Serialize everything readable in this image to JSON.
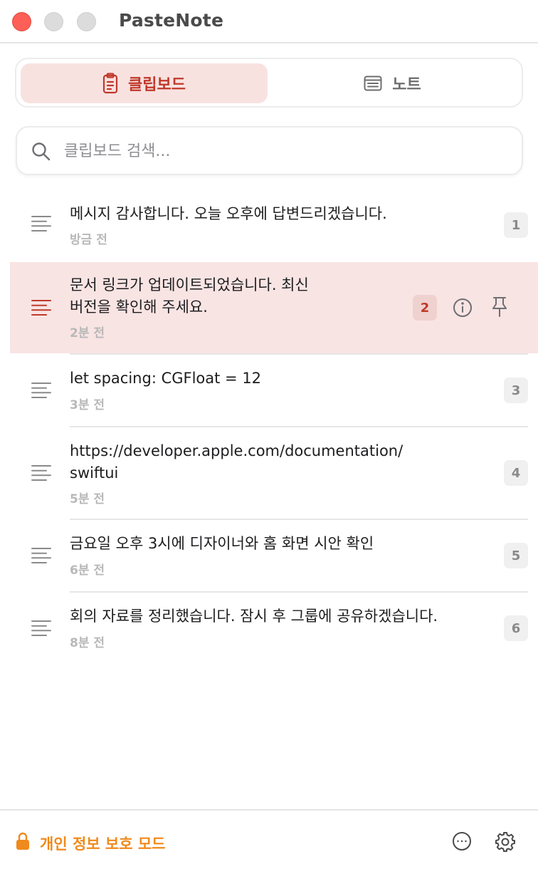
{
  "app": {
    "title": "PasteNote"
  },
  "tabs": {
    "clipboard": "클립보드",
    "notes": "노트"
  },
  "search": {
    "placeholder": "클립보드 검색..."
  },
  "items": [
    {
      "lines": [
        "메시지 감사합니다. 오늘 오후에 답변드리겠습니다."
      ],
      "time": "방금 전",
      "index": "1",
      "selected": false
    },
    {
      "lines": [
        "문서 링크가 업데이트되었습니다. 최신",
        "버전을 확인해 주세요."
      ],
      "time": "2분 전",
      "index": "2",
      "selected": true
    },
    {
      "lines": [
        "let spacing: CGFloat = 12"
      ],
      "time": "3분 전",
      "index": "3",
      "selected": false
    },
    {
      "lines": [
        "https://developer.apple.com/documentation/",
        "swiftui"
      ],
      "time": "5분 전",
      "index": "4",
      "selected": false
    },
    {
      "lines": [
        "금요일 오후 3시에 디자이너와 홈 화면 시안 확인"
      ],
      "time": "6분 전",
      "index": "5",
      "selected": false
    },
    {
      "lines": [
        "회의 자료를 정리했습니다. 잠시 후 그룹에 공유하겠습니다."
      ],
      "time": "8분 전",
      "index": "6",
      "selected": false
    }
  ],
  "footer": {
    "privacy_label": "개인 정보 보호 모드"
  },
  "icons": {
    "clipboard_tab": "clipboard-icon",
    "notes_tab": "note-icon",
    "search": "search-icon",
    "item": "text-lines-icon",
    "info": "info-icon",
    "pin": "pin-icon",
    "lock": "lock-icon",
    "more": "ellipsis-circle-icon",
    "settings": "gear-icon"
  },
  "colors": {
    "accent": "#c0392b",
    "selection_bg": "#f8e4e3",
    "privacy": "#f08a1c",
    "close": "#fe5f57"
  }
}
